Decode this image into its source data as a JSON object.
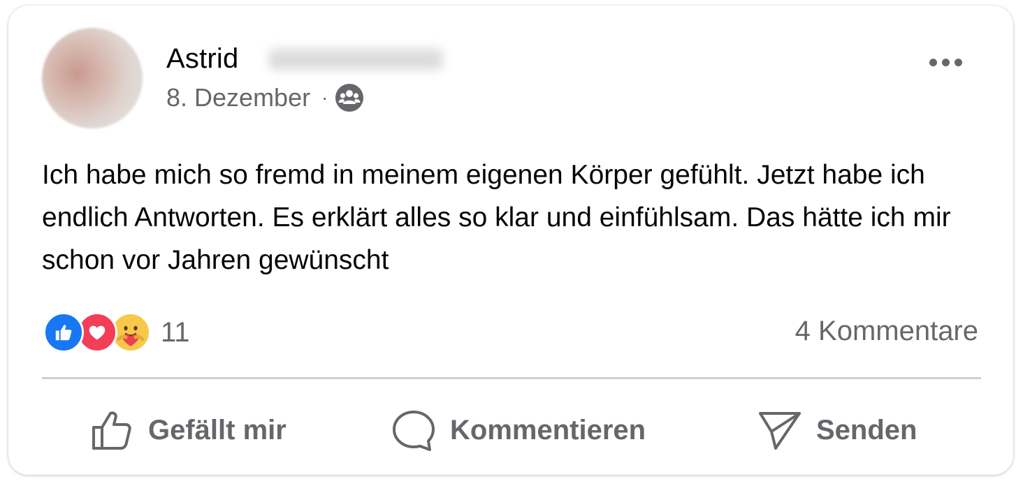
{
  "post": {
    "author_name": "Astrid",
    "date": "8. Dezember",
    "separator": "·",
    "audience_icon": "group-icon",
    "more_icon": "more-options-icon",
    "text": "Ich habe mich so fremd in meinem eigenen Körper gefühlt. Jetzt habe ich endlich Antworten. Es erklärt alles so klar und einfühlsam. Das hätte ich mir schon vor Jahren gewünscht"
  },
  "reactions": {
    "icons": [
      "like-reaction-icon",
      "love-reaction-icon",
      "care-reaction-icon"
    ],
    "count": "11",
    "comments": "4 Kommentare"
  },
  "actions": {
    "like_label": "Gefällt mir",
    "comment_label": "Kommentieren",
    "send_label": "Senden"
  },
  "colors": {
    "text_primary": "#050505",
    "text_secondary": "#65676b",
    "like_blue": "#1877f2",
    "love_red": "#f33e58",
    "care_yellow": "#f7c94b",
    "divider": "#ced0d4"
  }
}
